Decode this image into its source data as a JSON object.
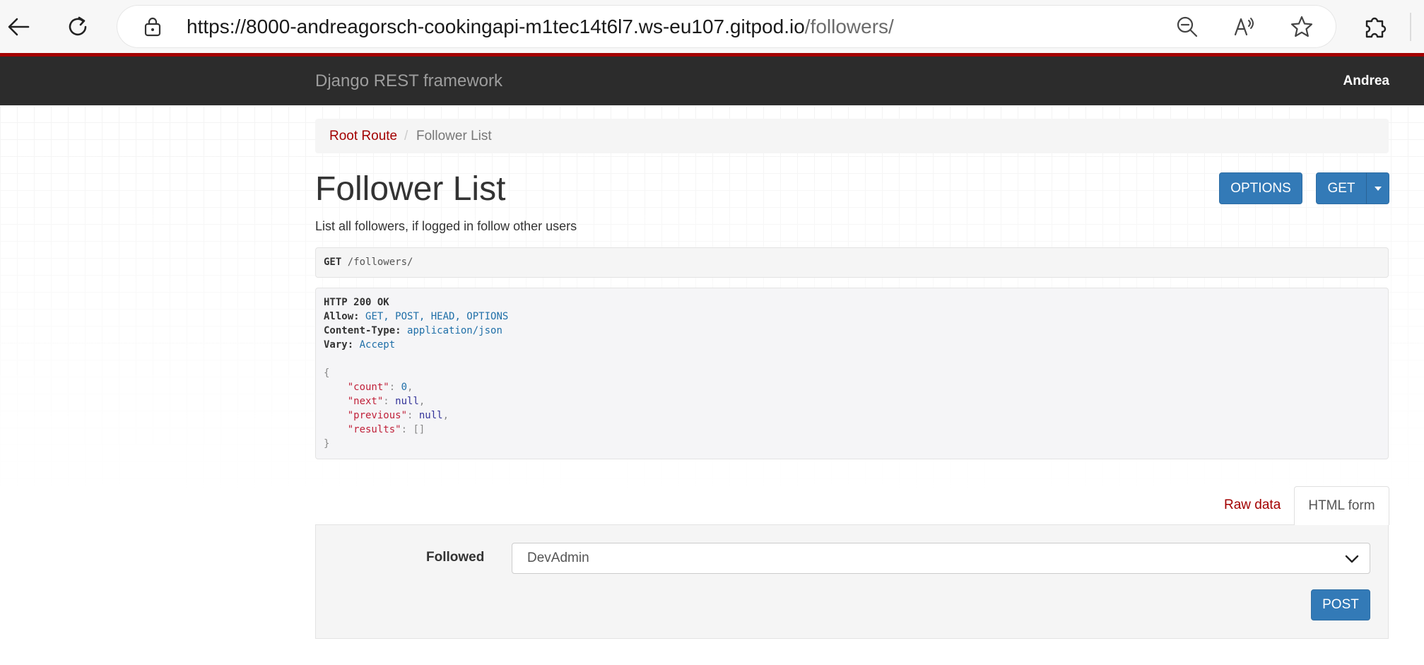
{
  "browser": {
    "url_base": "https://8000-andreagorsch-cookingapi-m1tec14t6l7.ws-eu107.gitpod.io",
    "url_path": "/followers/"
  },
  "navbar": {
    "brand": "Django REST framework",
    "user": "Andrea"
  },
  "breadcrumb": {
    "root": "Root Route",
    "separator": "/",
    "current": "Follower List"
  },
  "page": {
    "title": "Follower List",
    "description": "List all followers, if logged in follow other users"
  },
  "buttons": {
    "options": "OPTIONS",
    "get": "GET",
    "post": "POST"
  },
  "request": {
    "method": "GET",
    "path": "/followers/"
  },
  "response": {
    "status": "HTTP 200 OK",
    "allow_key": "Allow:",
    "allow_value": "GET, POST, HEAD, OPTIONS",
    "content_type_key": "Content-Type:",
    "content_type_value": "application/json",
    "vary_key": "Vary:",
    "vary_value": "Accept",
    "open_brace": "{",
    "close_brace": "}",
    "count_key": "\"count\"",
    "count_value": "0",
    "next_key": "\"next\"",
    "next_value": "null",
    "previous_key": "\"previous\"",
    "previous_value": "null",
    "results_key": "\"results\"",
    "results_value": "[]"
  },
  "tabs": {
    "raw": "Raw data",
    "html": "HTML form"
  },
  "form": {
    "followed_label": "Followed",
    "followed_value": "DevAdmin"
  }
}
